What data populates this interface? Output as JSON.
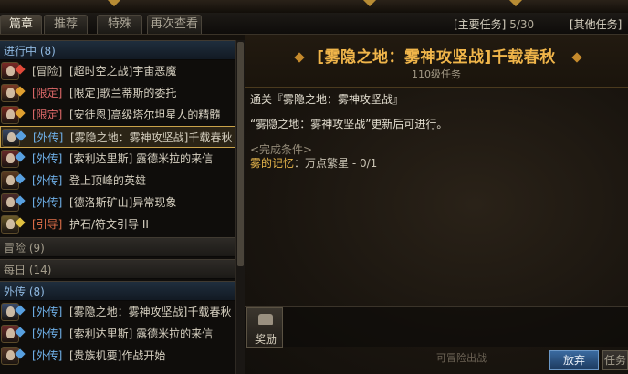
{
  "tabs": [
    {
      "label": "篇章",
      "active": true
    },
    {
      "label": "推荐",
      "active": false
    },
    {
      "label": "特殊",
      "active": false
    },
    {
      "label": "再次查看",
      "active": false
    }
  ],
  "counters": {
    "main": "[主要任务]",
    "main_count": "5/30",
    "other": "[其他任务]"
  },
  "categories": {
    "in_progress": "进行中 (8)",
    "adventure": "冒险 (9)",
    "daily": "每日 (14)",
    "side": "外传 (8)"
  },
  "in_progress_quests": [
    {
      "tag": "[冒险]",
      "tag_color": "#c9c3b3",
      "name": "[超时空之战]宇宙恶魔",
      "icon_color": "#7a2a26",
      "mark": "#e04a3a"
    },
    {
      "tag": "[限定]",
      "tag_color": "#e06a6a",
      "name": "[限定]歌兰蒂斯的委托",
      "icon_color": "#7a3a26",
      "mark": "#e0a030"
    },
    {
      "tag": "[限定]",
      "tag_color": "#e06a6a",
      "name": "[安徒恩]高级塔尔坦星人的精髓",
      "icon_color": "#7a2a20",
      "mark": "#e0a030"
    },
    {
      "tag": "[外传]",
      "tag_color": "#6fb0e8",
      "name": "[雾隐之地：雾神攻坚战]千载春秋",
      "icon_color": "#3a4a6a",
      "mark": "#58a0e0"
    },
    {
      "tag": "[外传]",
      "tag_color": "#6fb0e8",
      "name": "[索利达里斯] 露德米拉的来信",
      "icon_color": "#6a2a2a",
      "mark": "#58a0e0"
    },
    {
      "tag": "[外传]",
      "tag_color": "#6fb0e8",
      "name": "登上顶峰的英雄",
      "icon_color": "#5a3a22",
      "mark": "#58a0e0"
    },
    {
      "tag": "[外传]",
      "tag_color": "#6fb0e8",
      "name": "[德洛斯矿山]异常现象",
      "icon_color": "#4a2a2a",
      "mark": "#58a0e0"
    },
    {
      "tag": "[引导]",
      "tag_color": "#e0704a",
      "name": "护石/符文引导 II",
      "icon_color": "#6a5a2a",
      "mark": "#e0c040"
    }
  ],
  "side_quests": [
    {
      "tag": "[外传]",
      "tag_color": "#6fb0e8",
      "name": "[雾隐之地：雾神攻坚战]千载春秋",
      "icon_color": "#3a4a6a",
      "mark": "#58a0e0"
    },
    {
      "tag": "[外传]",
      "tag_color": "#6fb0e8",
      "name": "[索利达里斯] 露德米拉的来信",
      "icon_color": "#6a2a2a",
      "mark": "#58a0e0"
    },
    {
      "tag": "[外传]",
      "tag_color": "#6fb0e8",
      "name": "[贵族机要]作战开始",
      "icon_color": "#5a3a2a",
      "mark": "#58a0e0"
    }
  ],
  "detail": {
    "title": "[雾隐之地：雾神攻坚战]千载春秋",
    "subtitle": "110级任务",
    "desc1": "通关『雾隐之地：雾神攻坚战』",
    "desc2": "“雾隐之地：雾神攻坚战”更新后可进行。",
    "cond_label": "<完成条件>",
    "cond_key": "雾的记忆",
    "cond_value": "：万点繁星 - 0/1",
    "reward_label": "奖励",
    "hint": "可冒险出战",
    "abandon": "放弃",
    "next": "任务"
  }
}
